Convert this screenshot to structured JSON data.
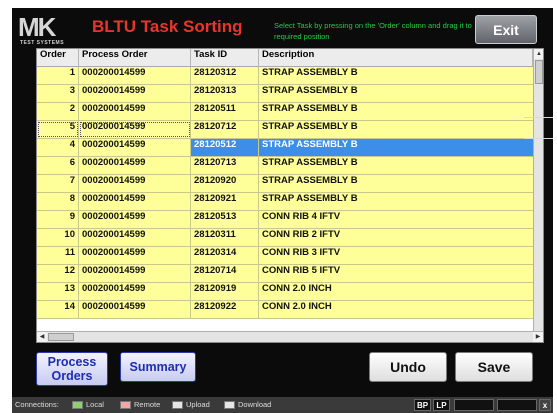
{
  "app": {
    "logo_text": "MK",
    "logo_subtext": "TEST SYSTEMS",
    "title": "BLTU Task Sorting",
    "hint": "Select Task by pressing on the 'Order' column and drag it to required position",
    "exit_label": "Exit"
  },
  "grid": {
    "columns": [
      "Order",
      "Process Order",
      "Task ID",
      "Description"
    ],
    "rows": [
      {
        "order": "1",
        "process_order": "000200014599",
        "task_id": "28120312",
        "description": "STRAP ASSEMBLY B"
      },
      {
        "order": "3",
        "process_order": "000200014599",
        "task_id": "28120313",
        "description": "STRAP ASSEMBLY B"
      },
      {
        "order": "2",
        "process_order": "000200014599",
        "task_id": "28120511",
        "description": "STRAP ASSEMBLY B"
      },
      {
        "order": "5",
        "process_order": "000200014599",
        "task_id": "28120712",
        "description": "STRAP ASSEMBLY B"
      },
      {
        "order": "4",
        "process_order": "000200014599",
        "task_id": "28120512",
        "description": "STRAP ASSEMBLY B",
        "selected": true
      },
      {
        "order": "6",
        "process_order": "000200014599",
        "task_id": "28120713",
        "description": "STRAP ASSEMBLY B"
      },
      {
        "order": "7",
        "process_order": "000200014599",
        "task_id": "28120920",
        "description": "STRAP ASSEMBLY B"
      },
      {
        "order": "8",
        "process_order": "000200014599",
        "task_id": "28120921",
        "description": "STRAP ASSEMBLY B"
      },
      {
        "order": "9",
        "process_order": "000200014599",
        "task_id": "28120513",
        "description": "CONN RIB 4 IFTV"
      },
      {
        "order": "10",
        "process_order": "000200014599",
        "task_id": "28120311",
        "description": "CONN RIB 2 IFTV"
      },
      {
        "order": "11",
        "process_order": "000200014599",
        "task_id": "28120314",
        "description": "CONN RIB 3 IFTV"
      },
      {
        "order": "12",
        "process_order": "000200014599",
        "task_id": "28120714",
        "description": "CONN RIB 5 IFTV"
      },
      {
        "order": "13",
        "process_order": "000200014599",
        "task_id": "28120919",
        "description": "CONN 2.0 INCH"
      },
      {
        "order": "14",
        "process_order": "000200014599",
        "task_id": "28120922",
        "description": "CONN 2.0 INCH"
      }
    ]
  },
  "buttons": {
    "process_orders": "Process Orders",
    "summary": "Summary",
    "undo": "Undo",
    "save": "Save"
  },
  "statusbar": {
    "label": "Connections:",
    "indicators": [
      {
        "label": "Local",
        "color": "#8fd16a"
      },
      {
        "label": "Remote",
        "color": "#f4a6a6"
      },
      {
        "label": "Upload",
        "color": "#e6e6e6"
      },
      {
        "label": "Download",
        "color": "#e6e6e6"
      }
    ],
    "bp": "BP",
    "lp": "LP",
    "close": "x"
  },
  "colors": {
    "title_red": "#e8352c",
    "hint_green": "#22cc44",
    "row_yellow": "#ffff99",
    "selected_blue": "#3d8ee6",
    "button_blue": "#1e2db0"
  }
}
